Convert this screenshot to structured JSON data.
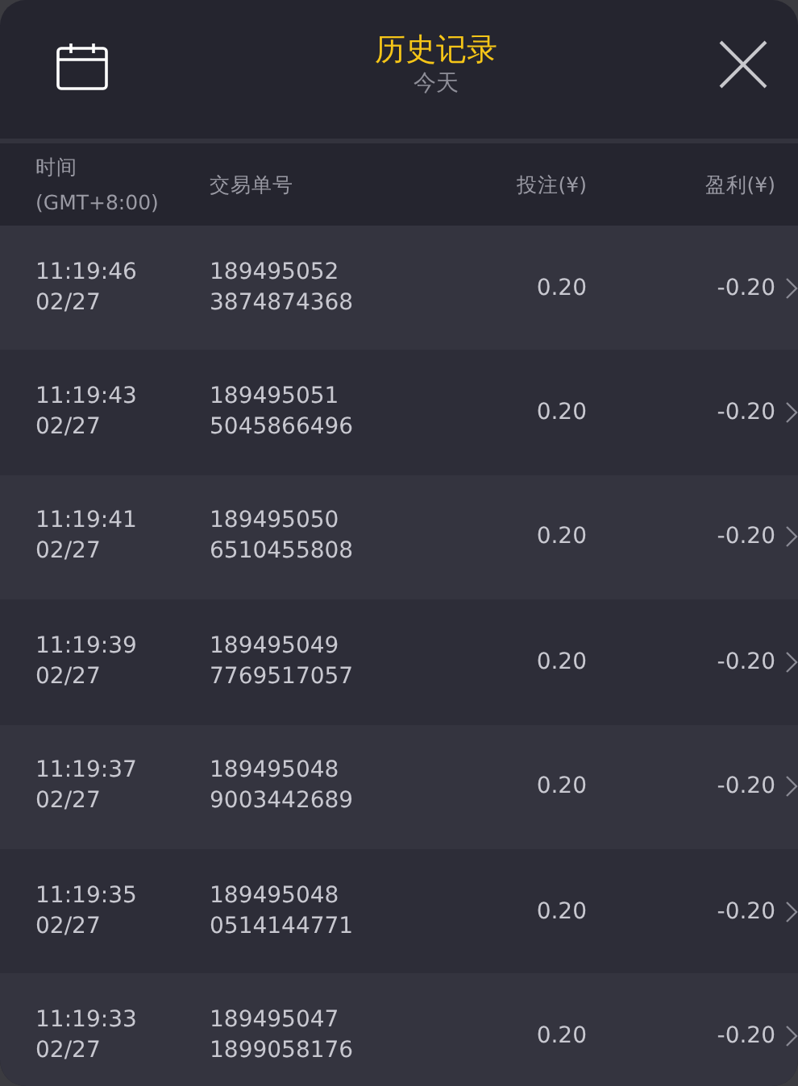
{
  "header": {
    "title": "历史记录",
    "subtitle": "今天"
  },
  "columns": [
    {
      "lines": [
        "时间",
        "(GMT+8:00)"
      ]
    },
    {
      "lines": [
        "交易单号"
      ]
    },
    {
      "lines": [
        "投注(¥)"
      ]
    },
    {
      "lines": [
        "盈利(¥)"
      ]
    }
  ],
  "rows": [
    {
      "time": "11:19:46",
      "date": "02/27",
      "order": [
        "189495052",
        "3874874368"
      ],
      "stake": "0.20",
      "profit": "-0.20"
    },
    {
      "time": "11:19:43",
      "date": "02/27",
      "order": [
        "189495051",
        "5045866496"
      ],
      "stake": "0.20",
      "profit": "-0.20"
    },
    {
      "time": "11:19:41",
      "date": "02/27",
      "order": [
        "189495050",
        "6510455808"
      ],
      "stake": "0.20",
      "profit": "-0.20"
    },
    {
      "time": "11:19:39",
      "date": "02/27",
      "order": [
        "189495049",
        "7769517057"
      ],
      "stake": "0.20",
      "profit": "-0.20"
    },
    {
      "time": "11:19:37",
      "date": "02/27",
      "order": [
        "189495048",
        "9003442689"
      ],
      "stake": "0.20",
      "profit": "-0.20"
    },
    {
      "time": "11:19:35",
      "date": "02/27",
      "order": [
        "189495048",
        "0514144771"
      ],
      "stake": "0.20",
      "profit": "-0.20"
    },
    {
      "time": "11:19:33",
      "date": "02/27",
      "order": [
        "189495047",
        "1899058176"
      ],
      "stake": "0.20",
      "profit": "-0.20"
    }
  ]
}
